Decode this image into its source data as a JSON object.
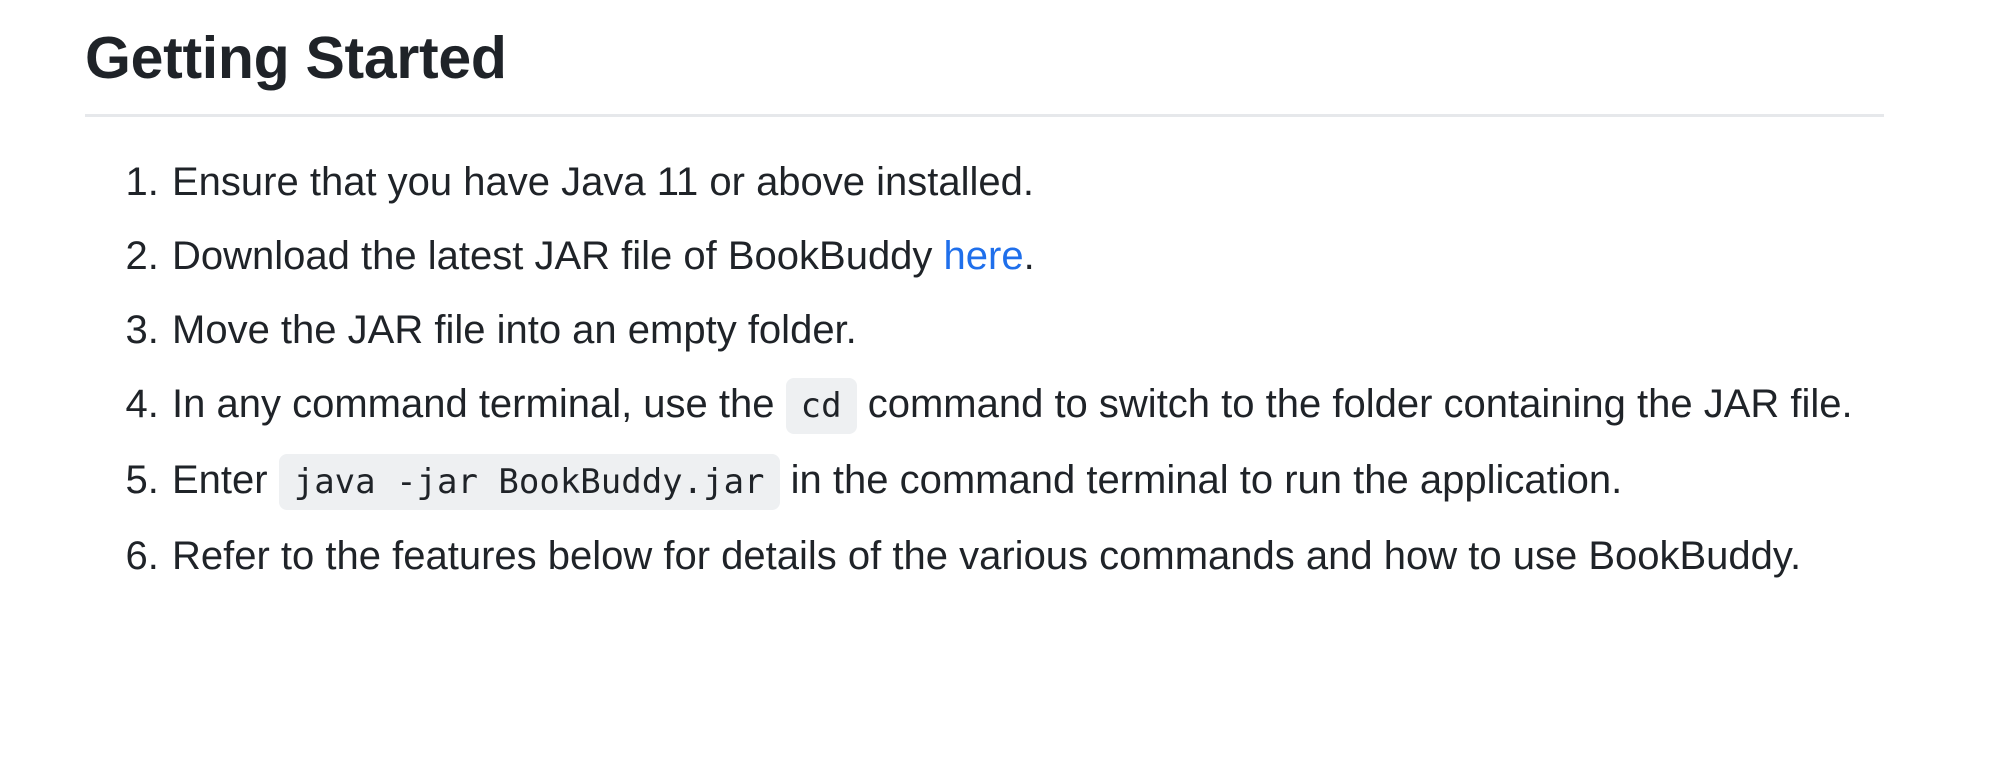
{
  "heading": "Getting Started",
  "steps": [
    {
      "text": "Ensure that you have Java 11 or above installed."
    },
    {
      "before": "Download the latest JAR file of BookBuddy ",
      "link": "here",
      "after": "."
    },
    {
      "text": "Move the JAR file into an empty folder."
    },
    {
      "before": "In any command terminal, use the ",
      "code": "cd",
      "after": " command to switch to the folder containing the JAR file."
    },
    {
      "before": "Enter ",
      "code": "java -jar BookBuddy.jar",
      "after": " in the command terminal to run the application."
    },
    {
      "text": "Refer to the features below for details of the various commands and how to use BookBuddy."
    }
  ],
  "colors": {
    "text": "#1f2328",
    "link": "#1f6feb",
    "code_bg": "#eef0f2",
    "divider": "#e6e8eb"
  }
}
